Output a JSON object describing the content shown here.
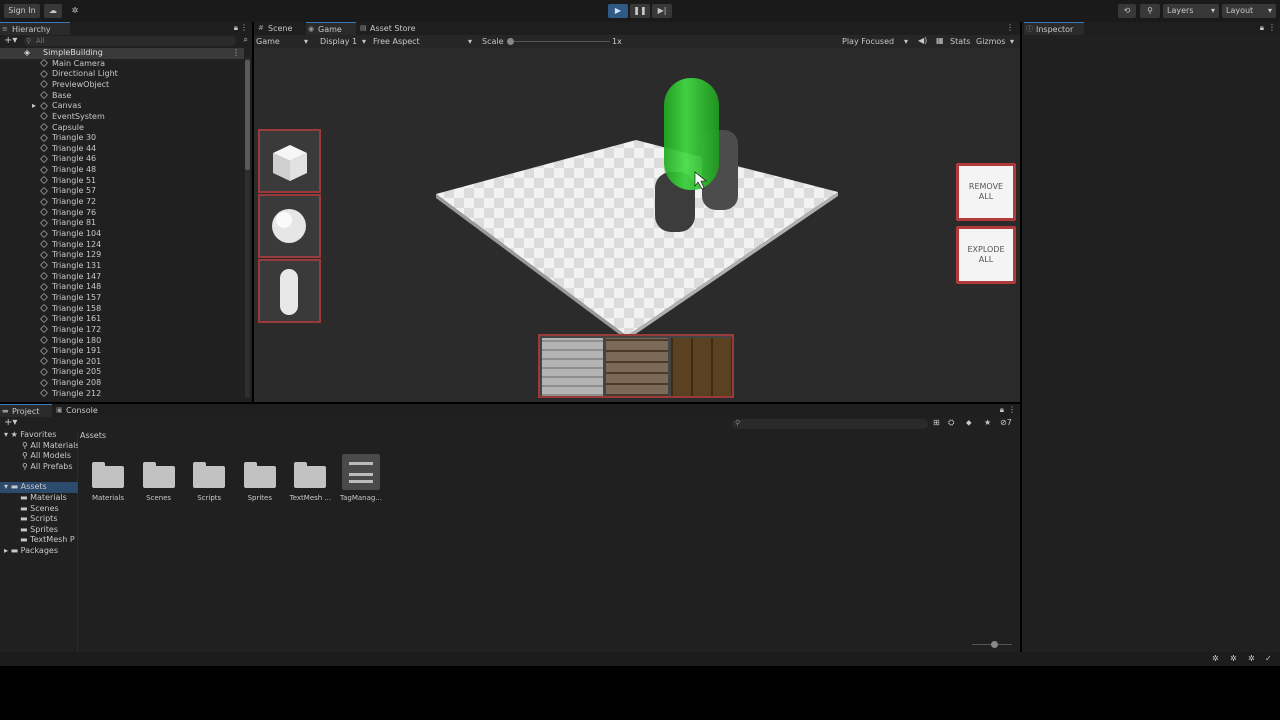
{
  "topbar": {
    "sign_in": "Sign In",
    "layers": "Layers",
    "layout": "Layout"
  },
  "hierarchy": {
    "tab": "Hierarchy",
    "search_placeholder": "All",
    "scene": "SimpleBuilding",
    "items": [
      "Main Camera",
      "Directional Light",
      "PreviewObject",
      "Base",
      "Canvas",
      "EventSystem",
      "Capsule",
      "Triangle 30",
      "Triangle 44",
      "Triangle 46",
      "Triangle 48",
      "Triangle 51",
      "Triangle 57",
      "Triangle 72",
      "Triangle 76",
      "Triangle 81",
      "Triangle 104",
      "Triangle 124",
      "Triangle 129",
      "Triangle 131",
      "Triangle 147",
      "Triangle 148",
      "Triangle 157",
      "Triangle 158",
      "Triangle 161",
      "Triangle 172",
      "Triangle 180",
      "Triangle 191",
      "Triangle 201",
      "Triangle 205",
      "Triangle 208",
      "Triangle 212"
    ]
  },
  "gameview": {
    "tabs": [
      "Scene",
      "Game",
      "Asset Store"
    ],
    "mode": "Game",
    "display": "Display 1",
    "aspect": "Free Aspect",
    "scale_label": "Scale",
    "scale_value": "1x",
    "play_focused": "Play Focused",
    "stats": "Stats",
    "gizmos": "Gizmos",
    "remove_all": "REMOVE ALL",
    "explode_all": "EXPLODE ALL"
  },
  "inspector": {
    "tab": "Inspector"
  },
  "project": {
    "tabs": [
      "Project",
      "Console"
    ],
    "breadcrumb": "Assets",
    "favorites_label": "Favorites",
    "favorites": [
      "All Materials",
      "All Models",
      "All Prefabs"
    ],
    "assets_label": "Assets",
    "asset_folders": [
      "Materials",
      "Scenes",
      "Scripts",
      "Sprites",
      "TextMesh P"
    ],
    "packages_label": "Packages",
    "grid_items": [
      "Materials",
      "Scenes",
      "Scripts",
      "Sprites",
      "TextMesh ...",
      "TagManag..."
    ],
    "hidden_count": "7"
  },
  "colors": {
    "accent": "#3a79bb",
    "capsule_green": "#33cc33",
    "button_border": "#b03a3a"
  }
}
